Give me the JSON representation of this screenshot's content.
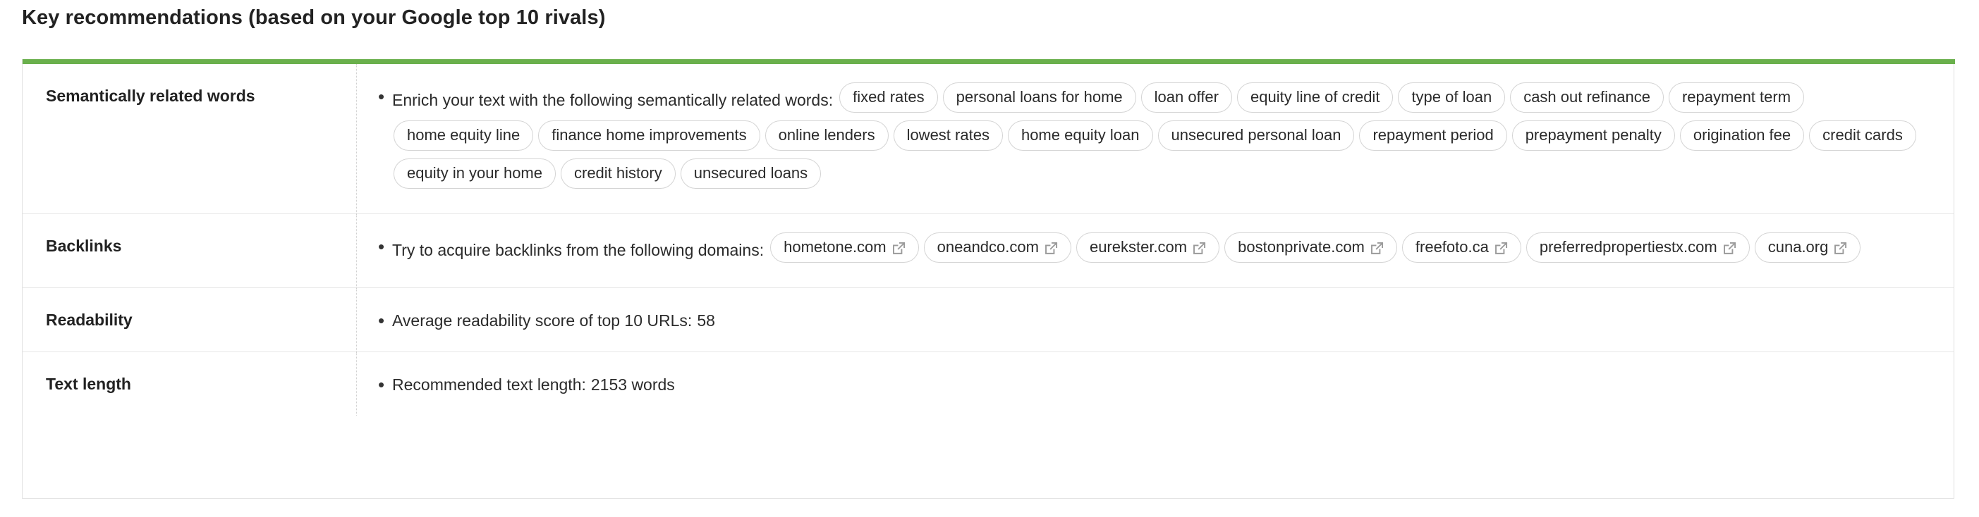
{
  "page_title": "Key recommendations (based on your Google top 10 rivals)",
  "accent_color": "#6ab04c",
  "bullet_glyph": "•",
  "table": {
    "rows": [
      {
        "label": "Semantically related words",
        "lead_text": "Enrich your text with the following semantically related words:",
        "type": "tags",
        "tags": [
          "fixed rates",
          "personal loans for home",
          "loan offer",
          "equity line of credit",
          "type of loan",
          "cash out refinance",
          "repayment term",
          "home equity line",
          "finance home improvements",
          "online lenders",
          "lowest rates",
          "home equity loan",
          "unsecured personal loan",
          "repayment period",
          "prepayment penalty",
          "origination fee",
          "credit cards",
          "equity in your home",
          "credit history",
          "unsecured loans"
        ]
      },
      {
        "label": "Backlinks",
        "lead_text": "Try to acquire backlinks from the following domains:",
        "type": "link-tags",
        "tags": [
          "hometone.com",
          "oneandco.com",
          "eurekster.com",
          "bostonprivate.com",
          "freefoto.ca",
          "preferredpropertiestx.com",
          "cuna.org"
        ],
        "icon": "external-link-icon"
      },
      {
        "label": "Readability",
        "lead_text": "Average readability score of top 10 URLs:",
        "type": "text",
        "value": "58"
      },
      {
        "label": "Text length",
        "lead_text": "Recommended text length:",
        "type": "text",
        "value": "2153 words"
      }
    ]
  }
}
